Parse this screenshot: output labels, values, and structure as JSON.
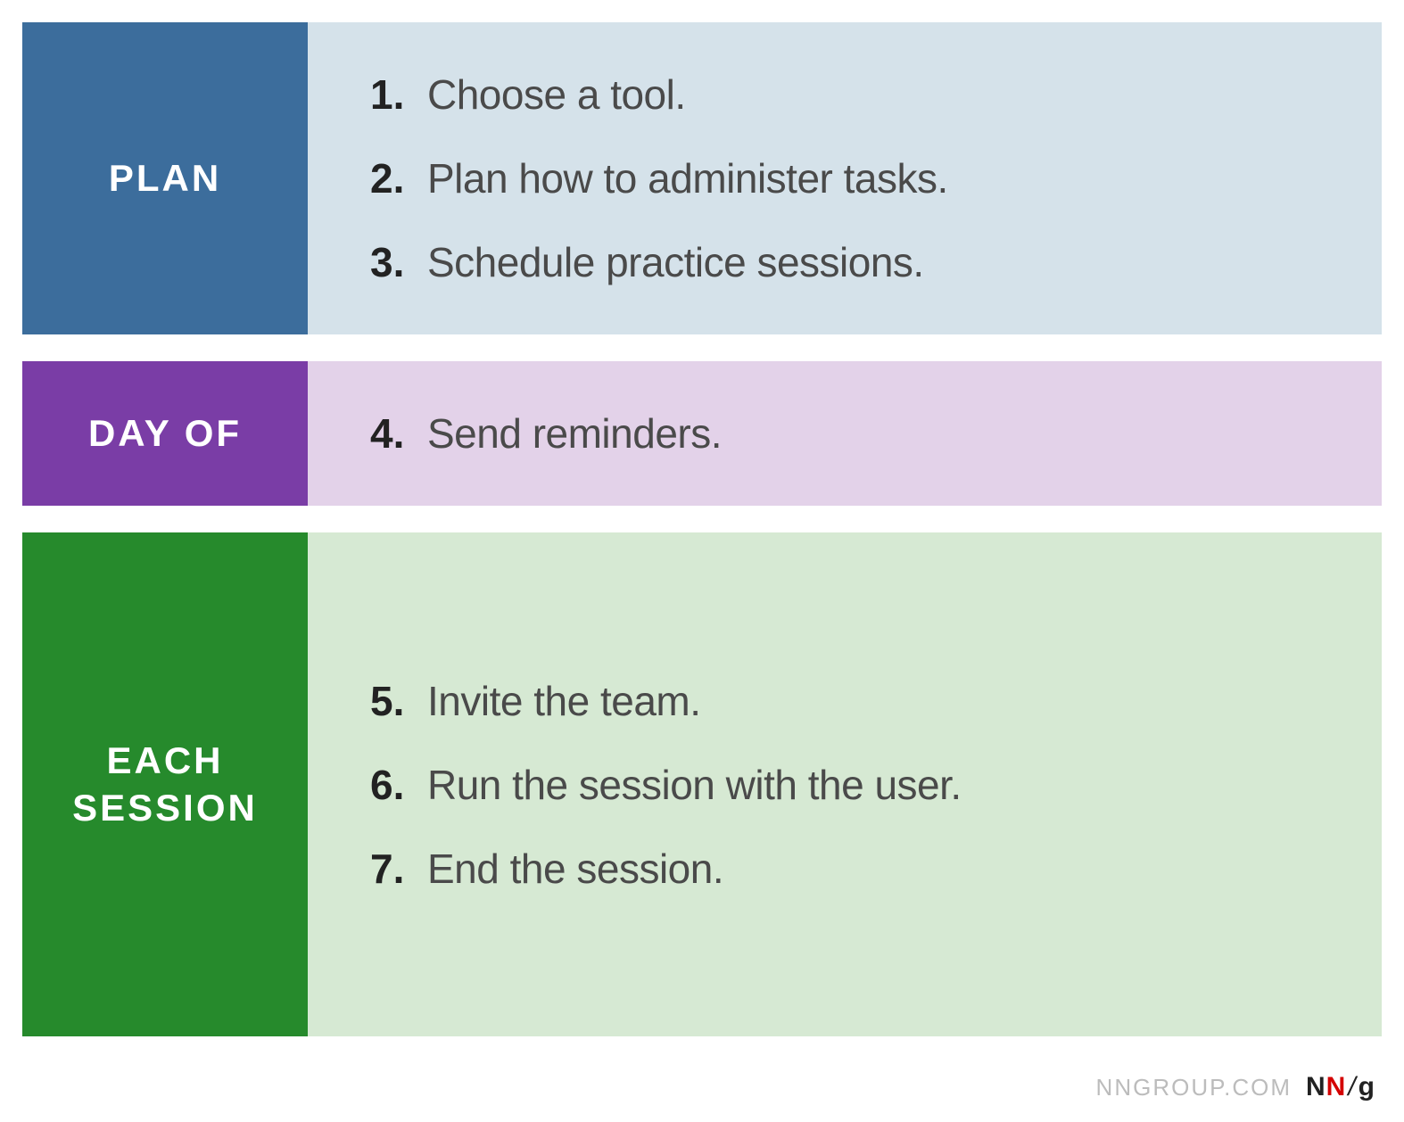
{
  "sections": {
    "plan": {
      "label": "PLAN",
      "items": [
        {
          "num": "1.",
          "text": "Choose a tool."
        },
        {
          "num": "2.",
          "text": "Plan how to administer tasks."
        },
        {
          "num": "3.",
          "text": "Schedule practice sessions."
        }
      ]
    },
    "dayof": {
      "label": "DAY OF",
      "items": [
        {
          "num": "4.",
          "text": "Send reminders."
        }
      ]
    },
    "each": {
      "label": "EACH SESSION",
      "items": [
        {
          "num": "5.",
          "text": "Invite the team."
        },
        {
          "num": "6.",
          "text": "Run the session with the user."
        },
        {
          "num": "7.",
          "text": "End the session."
        }
      ]
    }
  },
  "footer": {
    "url": "NNGROUP.COM",
    "logo": {
      "n1": "N",
      "n2": "N",
      "slash": "/",
      "g": "g"
    }
  }
}
